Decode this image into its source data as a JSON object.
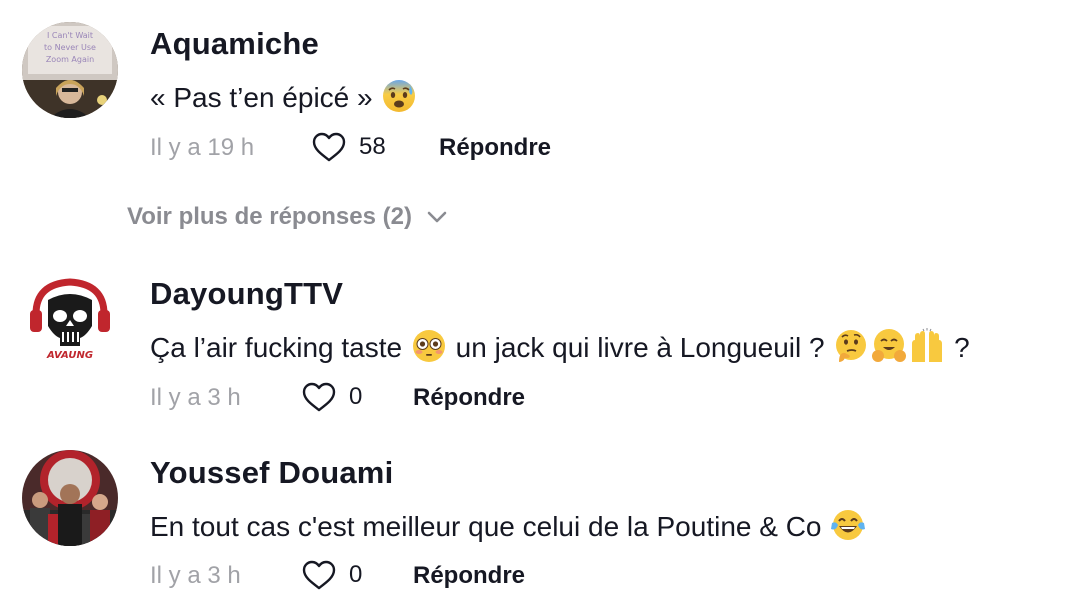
{
  "comments": [
    {
      "username": "Aquamiche",
      "text_before": "« Pas t’en épicé » ",
      "time": "Il y a 19 h",
      "likes": "58",
      "reply_label": "Répondre",
      "avatar_sign_lines": [
        "I Can't Wait",
        "to Never Use",
        "Zoom Again"
      ]
    },
    {
      "username": "DayoungTTV",
      "text_part1": "Ça l’air fucking taste ",
      "text_part2": " un jack qui livre à Longueuil ? ",
      "text_part3": " ?",
      "time": "Il y a 3 h",
      "likes": "0",
      "reply_label": "Répondre",
      "avatar_logo_text": "AVAUNG"
    },
    {
      "username": "Youssef Douami",
      "text_before": "En tout cas c'est meilleur que celui de la Poutine & Co ",
      "time": "Il y a 3 h",
      "likes": "0",
      "reply_label": "Répondre"
    }
  ],
  "more_replies": "Voir plus de réponses (2)",
  "icons": {
    "like": "heart-outline-icon",
    "expand": "chevron-down-icon",
    "emoji_1": "anxious-face-with-sweat-emoji",
    "emoji_2": "flushed-face-emoji",
    "emoji_3": "thinking-face-emoji",
    "emoji_4": "hugging-face-emoji",
    "emoji_5": "raising-hands-emoji",
    "emoji_6": "face-with-tears-of-joy-emoji"
  },
  "colors": {
    "text": "#161823",
    "muted": "#a1a2a7",
    "more_link": "#8a8b91"
  }
}
